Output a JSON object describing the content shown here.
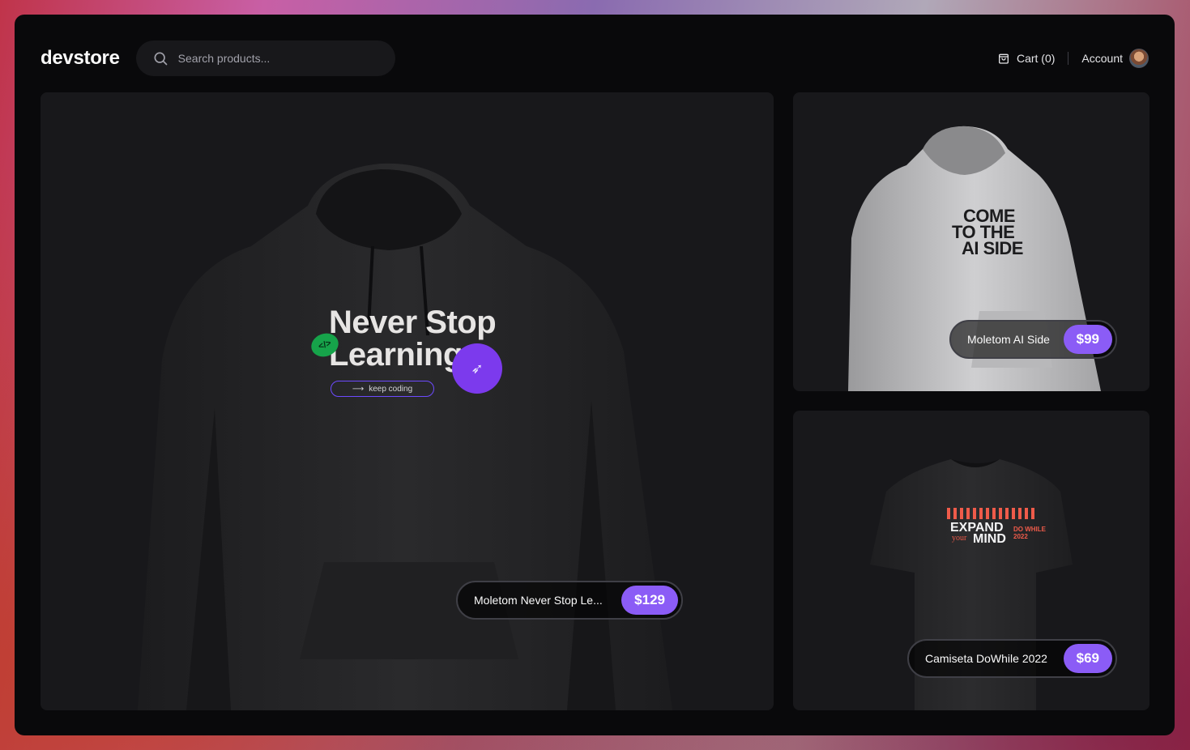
{
  "app": {
    "logo": "devstore"
  },
  "search": {
    "placeholder": "Search products..."
  },
  "header": {
    "cart_label": "Cart (0)",
    "account_label": "Account"
  },
  "products": [
    {
      "name": "Moletom Never Stop Le...",
      "price": "$129",
      "print": {
        "line1": "Never Stop",
        "line2": "Learning",
        "tagline": "keep coding",
        "sticker": "ROCKETSEAT",
        "code": "</>"
      }
    },
    {
      "name": "Moletom AI Side",
      "price": "$99",
      "print": {
        "line1": "COME",
        "line2": "TO THE",
        "line3": "AI SIDE"
      }
    },
    {
      "name": "Camiseta DoWhile 2022",
      "price": "$69",
      "print": {
        "line1": "EXPAND",
        "line2": "MIND",
        "small1": "your",
        "small2": "DO WHILE 2022"
      }
    }
  ],
  "colors": {
    "accent": "#8b5cf6",
    "background": "#09090b",
    "card": "#18181b"
  }
}
